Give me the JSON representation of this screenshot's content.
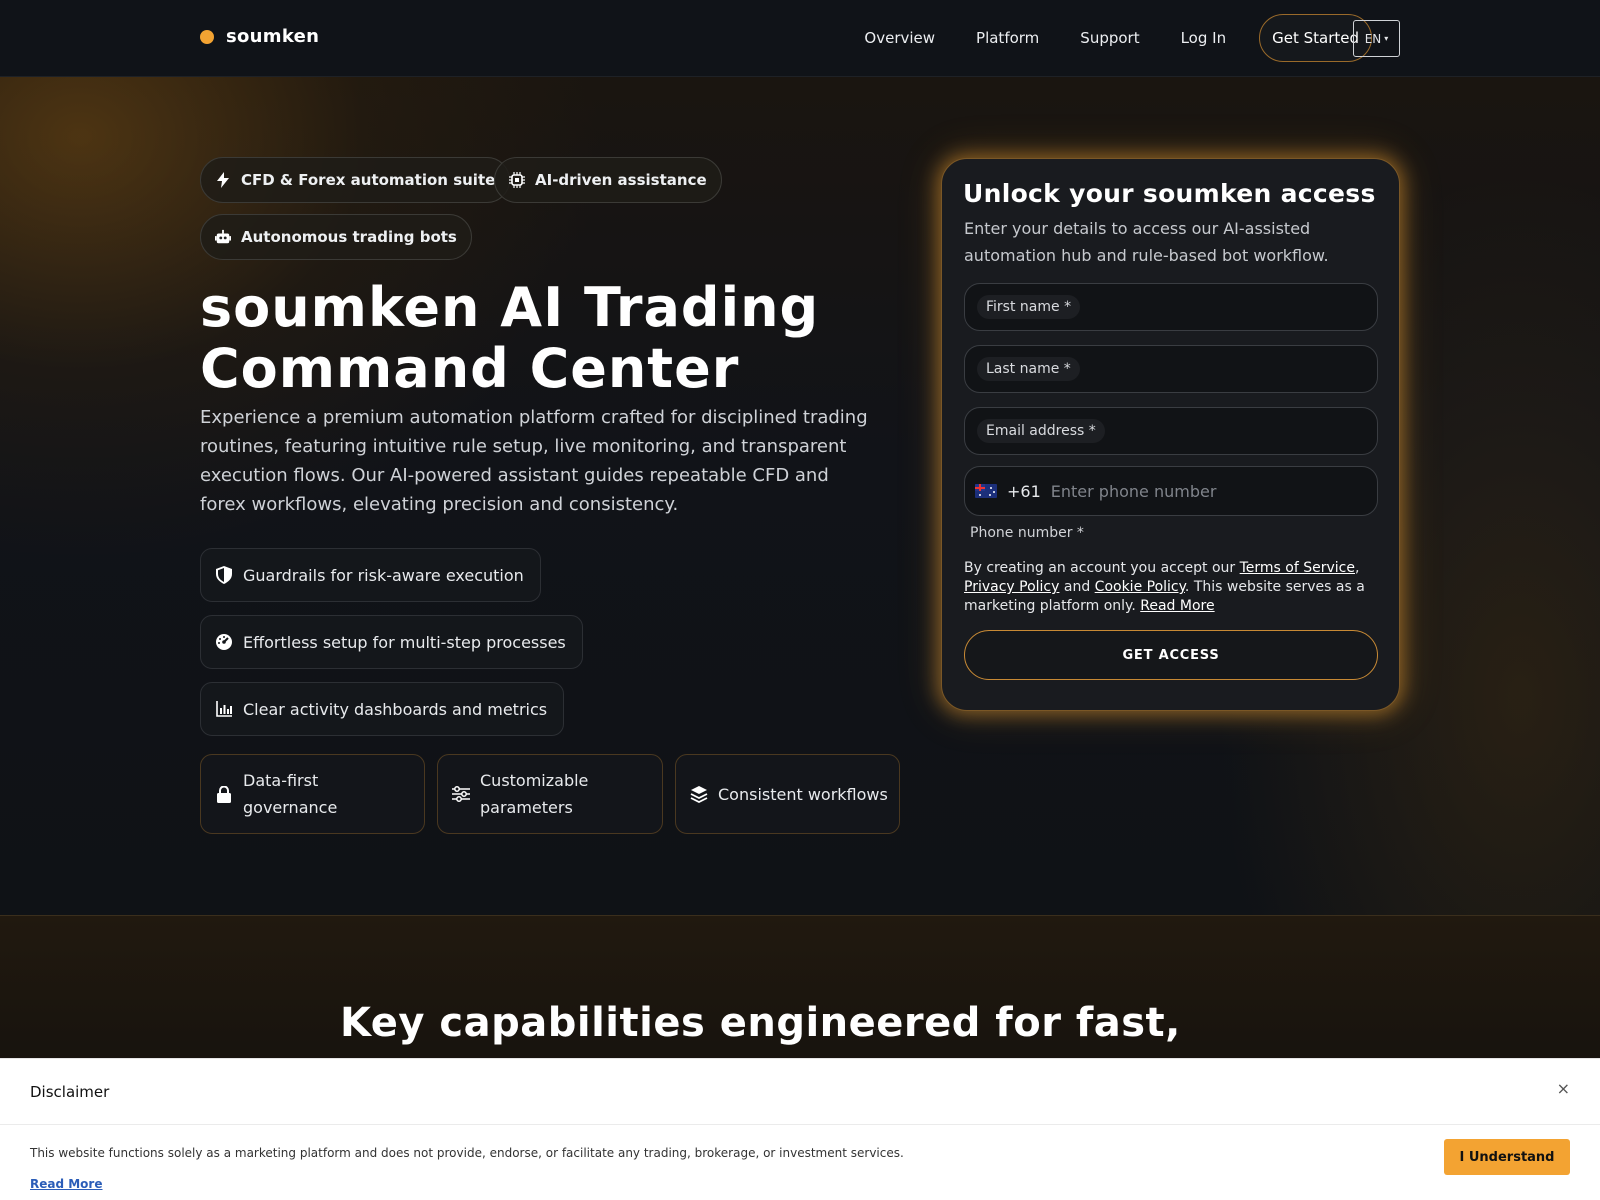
{
  "nav": {
    "brand": "soumken",
    "links": [
      "Overview",
      "Platform",
      "Support",
      "Log In"
    ],
    "cta": "Get Started",
    "language": "EN"
  },
  "hero": {
    "badges": [
      {
        "label": "CFD & Forex automation suite",
        "icon": "bolt-icon"
      },
      {
        "label": "AI-driven assistance",
        "icon": "chip-icon"
      },
      {
        "label": "Autonomous trading bots",
        "icon": "robot-icon"
      }
    ],
    "title_line1": "soumken AI Trading",
    "title_line2": "Command Center",
    "description": "Experience a premium automation platform crafted for disciplined trading routines, featuring intuitive rule setup, live monitoring, and transparent execution flows. Our AI-powered assistant guides repeatable CFD and forex workflows, elevating precision and consistency.",
    "features": [
      {
        "label": "Guardrails for risk-aware execution",
        "icon": "shield-icon"
      },
      {
        "label": "Effortless setup for multi-step processes",
        "icon": "gauge-icon"
      },
      {
        "label": "Clear activity dashboards and metrics",
        "icon": "bar-chart-icon"
      }
    ],
    "cards": [
      {
        "label": "Data-first governance",
        "icon": "lock-icon"
      },
      {
        "label": "Customizable parameters",
        "icon": "sliders-icon"
      },
      {
        "label": "Consistent workflows",
        "icon": "layers-icon"
      }
    ]
  },
  "form": {
    "title": "Unlock your soumken access",
    "subtitle": "Enter your details to access our AI-assisted automation hub and rule-based bot workflow.",
    "first_name_label": "First name *",
    "last_name_label": "Last name *",
    "email_label": "Email address *",
    "dial_code": "+61",
    "phone_placeholder": "Enter phone number",
    "phone_label": "Phone number *",
    "terms_prefix": "By creating an account you accept our ",
    "terms_link": "Terms of Service",
    "privacy_link": "Privacy Policy",
    "terms_and": " and ",
    "cookie_link": "Cookie Policy",
    "terms_suffix": ". This website serves as a marketing platform only. ",
    "read_more": "Read More",
    "submit": "GET ACCESS"
  },
  "section2": {
    "title": "Key capabilities engineered for fast, dependable automation"
  },
  "disclaimer": {
    "title": "Disclaimer",
    "close": "×",
    "text": "This website functions solely as a marketing platform and does not provide, endorse, or facilitate any trading, brokerage, or investment services.",
    "read_more": "Read More",
    "button": "I Understand"
  },
  "colors": {
    "accent": "#f3a332",
    "background": "#0f1216",
    "card_border": "#7a5726"
  }
}
